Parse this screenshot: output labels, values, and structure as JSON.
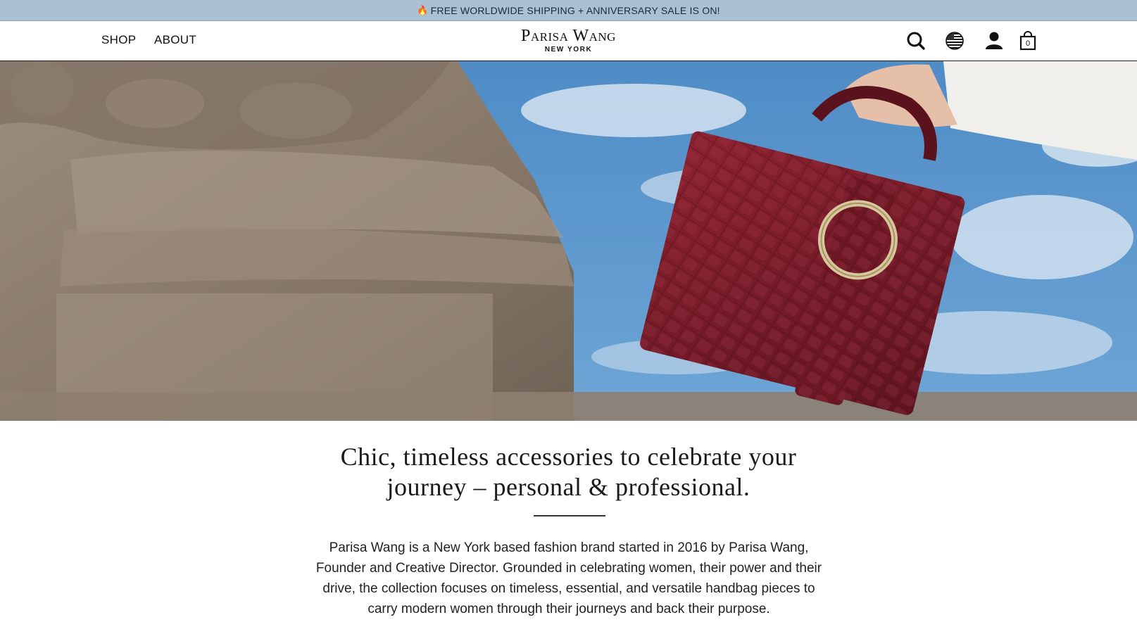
{
  "announcement": {
    "icon": "fire-icon",
    "text": "FREE WORLDWIDE SHIPPING + ANNIVERSARY SALE IS ON!"
  },
  "nav": {
    "shop": "SHOP",
    "about": "ABOUT"
  },
  "logo": {
    "main": "Parisa Wang",
    "sub": "NEW YORK"
  },
  "header_icons": {
    "search": "search-icon",
    "region": "globe-flag-icon",
    "account": "account-icon",
    "cart": "shopping-bag-icon",
    "cart_count": "0"
  },
  "hero": {
    "image": "burgundy croc-embossed handbag with gold ring held against sky beside carved stone"
  },
  "tagline": {
    "line1": "Chic, timeless accessories to celebrate your",
    "line2": "journey – personal & professional."
  },
  "about": {
    "text": "Parisa Wang is a New York based fashion brand started in 2016 by Parisa Wang, Founder and Creative Director. Grounded in celebrating women, their power and their drive, the collection focuses on timeless, essential, and versatile handbag pieces to carry modern women through their journeys and back their purpose."
  },
  "colors": {
    "announcement_bg": "#a9c1d3",
    "bag": "#7a1a26",
    "sky": "#5a93c9",
    "stone": "#8e8072"
  }
}
